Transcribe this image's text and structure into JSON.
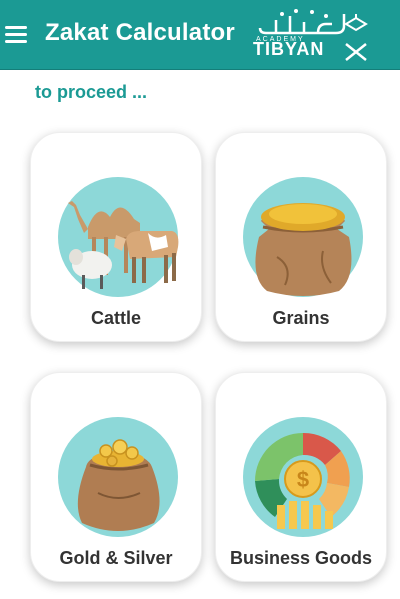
{
  "header": {
    "title": "Zakat Calculator",
    "logo_arabic": "تبيان",
    "logo_academy": "ACADEMY",
    "logo_name": "TIBYAN"
  },
  "prompt_text": "to proceed ...",
  "categories": [
    {
      "label": "Cattle",
      "icon": "cattle-icon"
    },
    {
      "label": "Grains",
      "icon": "grain-sack-icon"
    },
    {
      "label": "Gold & Silver",
      "icon": "gold-bag-icon"
    },
    {
      "label": "Business Goods",
      "icon": "business-chart-icon"
    }
  ],
  "colors": {
    "primary": "#1b9a94",
    "circle_bg": "#8dd8d8",
    "label_text": "#333333"
  }
}
